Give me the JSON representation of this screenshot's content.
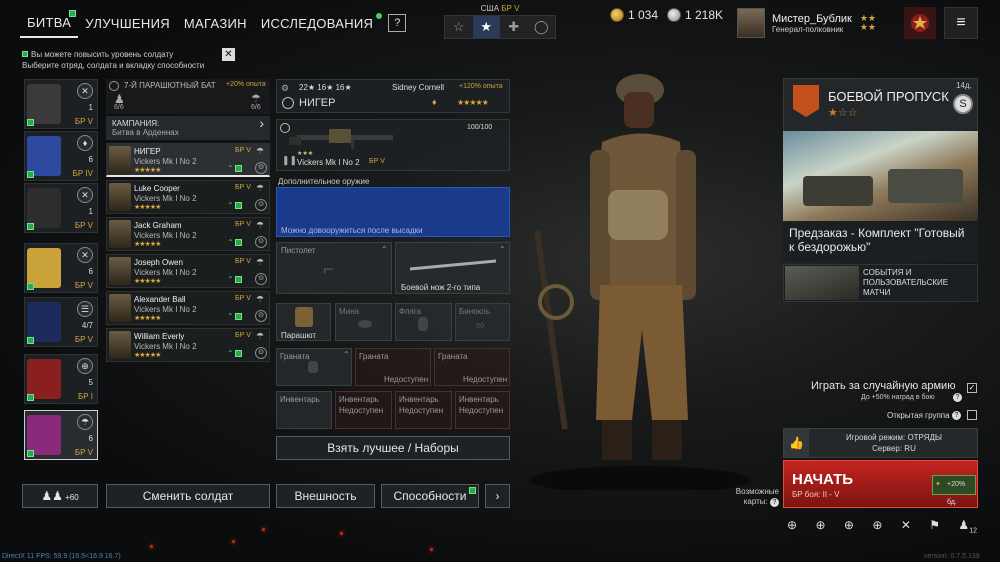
{
  "nav": {
    "tabs": [
      {
        "label": "БИТВА"
      },
      {
        "label": "УЛУЧШЕНИЯ"
      },
      {
        "label": "МАГАЗИН"
      },
      {
        "label": "ИССЛЕДОВАНИЯ"
      }
    ],
    "help_label": "?"
  },
  "nation": {
    "country": "США",
    "br": "БР V"
  },
  "currency": {
    "gold": "1 034",
    "silver": "1 218K"
  },
  "profile": {
    "name": "Мистер_Бублик",
    "rank": "Генерал-полковник"
  },
  "notice": {
    "line1": "Вы можете повысить уровень солдату",
    "line2": "Выберите отряд, солдата и вкладку способности",
    "close": "✕"
  },
  "squads": [
    {
      "count": "1",
      "br": "БР V",
      "color": "#fff",
      "emblem": "#3a3a3a"
    },
    {
      "count": "6",
      "br": "БР IV",
      "color": "#fff",
      "emblem": "#2d4a9e"
    },
    {
      "count": "1",
      "br": "БР V",
      "color": "#fff",
      "emblem": "#2d2d2d"
    },
    {
      "count": "6",
      "br": "БР V",
      "color": "#fff",
      "emblem": "#c9a23a"
    },
    {
      "count": "4/7",
      "br": "БР V",
      "color": "#fff",
      "emblem": "#1c2a5e"
    },
    {
      "count": "5",
      "br": "БР I",
      "color": "#fff",
      "emblem": "#8a1f1f"
    },
    {
      "count": "6",
      "br": "БР V",
      "color": "#fff",
      "emblem": "#8a2a7a"
    }
  ],
  "squad_header": {
    "title": "7-Й ПАРАШЮТНЫЙ БАТ",
    "exp": "+20% опыта",
    "count1": "6/6",
    "count2": "6/6"
  },
  "campaign": {
    "label": "КАМПАНИЯ:",
    "name": "Битва в Арденнах"
  },
  "soldiers": [
    {
      "name": "НИГЕР",
      "weapon": "Vickers Mk I No 2",
      "br": "БР V",
      "stars": "★★★★★"
    },
    {
      "name": "Luke Cooper",
      "weapon": "Vickers Mk I No 2",
      "br": "БР V",
      "stars": "★★★★★"
    },
    {
      "name": "Jack Graham",
      "weapon": "Vickers Mk I No 2",
      "br": "БР V",
      "stars": "★★★★★"
    },
    {
      "name": "Joseph Owen",
      "weapon": "Vickers Mk I No 2",
      "br": "БР V",
      "stars": "★★★★★"
    },
    {
      "name": "Alexander Ball",
      "weapon": "Vickers Mk I No 2",
      "br": "БР V",
      "stars": "★★★★★"
    },
    {
      "name": "William Everly",
      "weapon": "Vickers Mk I No 2",
      "br": "БР V",
      "stars": "★★★★★"
    }
  ],
  "soldier_detail": {
    "stats": "22★  16★  16★",
    "partner": "Sidney Cornell",
    "exp": "+120% опыта",
    "name": "НИГЕР",
    "stars": "★★★★★"
  },
  "loadout": {
    "main_weapon": "Vickers Mk I No 2",
    "main_br": "БР V",
    "main_stars": "★★★",
    "ammo": "100/100",
    "extra_label": "Дополнительное оружие",
    "extra_hint": "Можно довооружиться после высадки",
    "pistol": "Пистолет",
    "knife": "Боевой нож 2-го типа",
    "parachute": "Парашют",
    "mine": "Мина",
    "flask": "Фляга",
    "binoculars": "Бинокль",
    "grenade": "Граната",
    "unavailable": "Недоступен",
    "inventory": "Инвентарь",
    "take_best": "Взять лучшее / Наборы"
  },
  "bottom": {
    "reserve": "+60",
    "change_soldier": "Сменить солдат",
    "appearance": "Внешность",
    "abilities": "Способности",
    "next": "›"
  },
  "battlepass": {
    "title": "БОЕВОЙ ПРОПУСК",
    "days": "14д.",
    "stars": "★☆☆",
    "preorder": "Предзаказ - Комплект \"Готовый к бездорожью\"",
    "events": "СОБЫТИЯ И ПОЛЬЗОВАТЕЛЬСКИЕ МАТЧИ"
  },
  "options": {
    "random_army": "Играть за случайную армию",
    "bonus": "До +50% наград в бою",
    "open_group": "Открытая группа"
  },
  "mode": {
    "mode": "Игровой режим: ОТРЯДЫ",
    "server": "Сервер: RU"
  },
  "start": {
    "label": "НАЧАТЬ",
    "br": "БР боя: II - V",
    "xp": "+20% бд."
  },
  "possible_maps": "Возможные карты:",
  "group_count": "12",
  "footer": {
    "fps": "DirectX 11 FPS: 59.9 (16.5<16.9 16.7)",
    "version": "version: 0.7.5.139"
  }
}
